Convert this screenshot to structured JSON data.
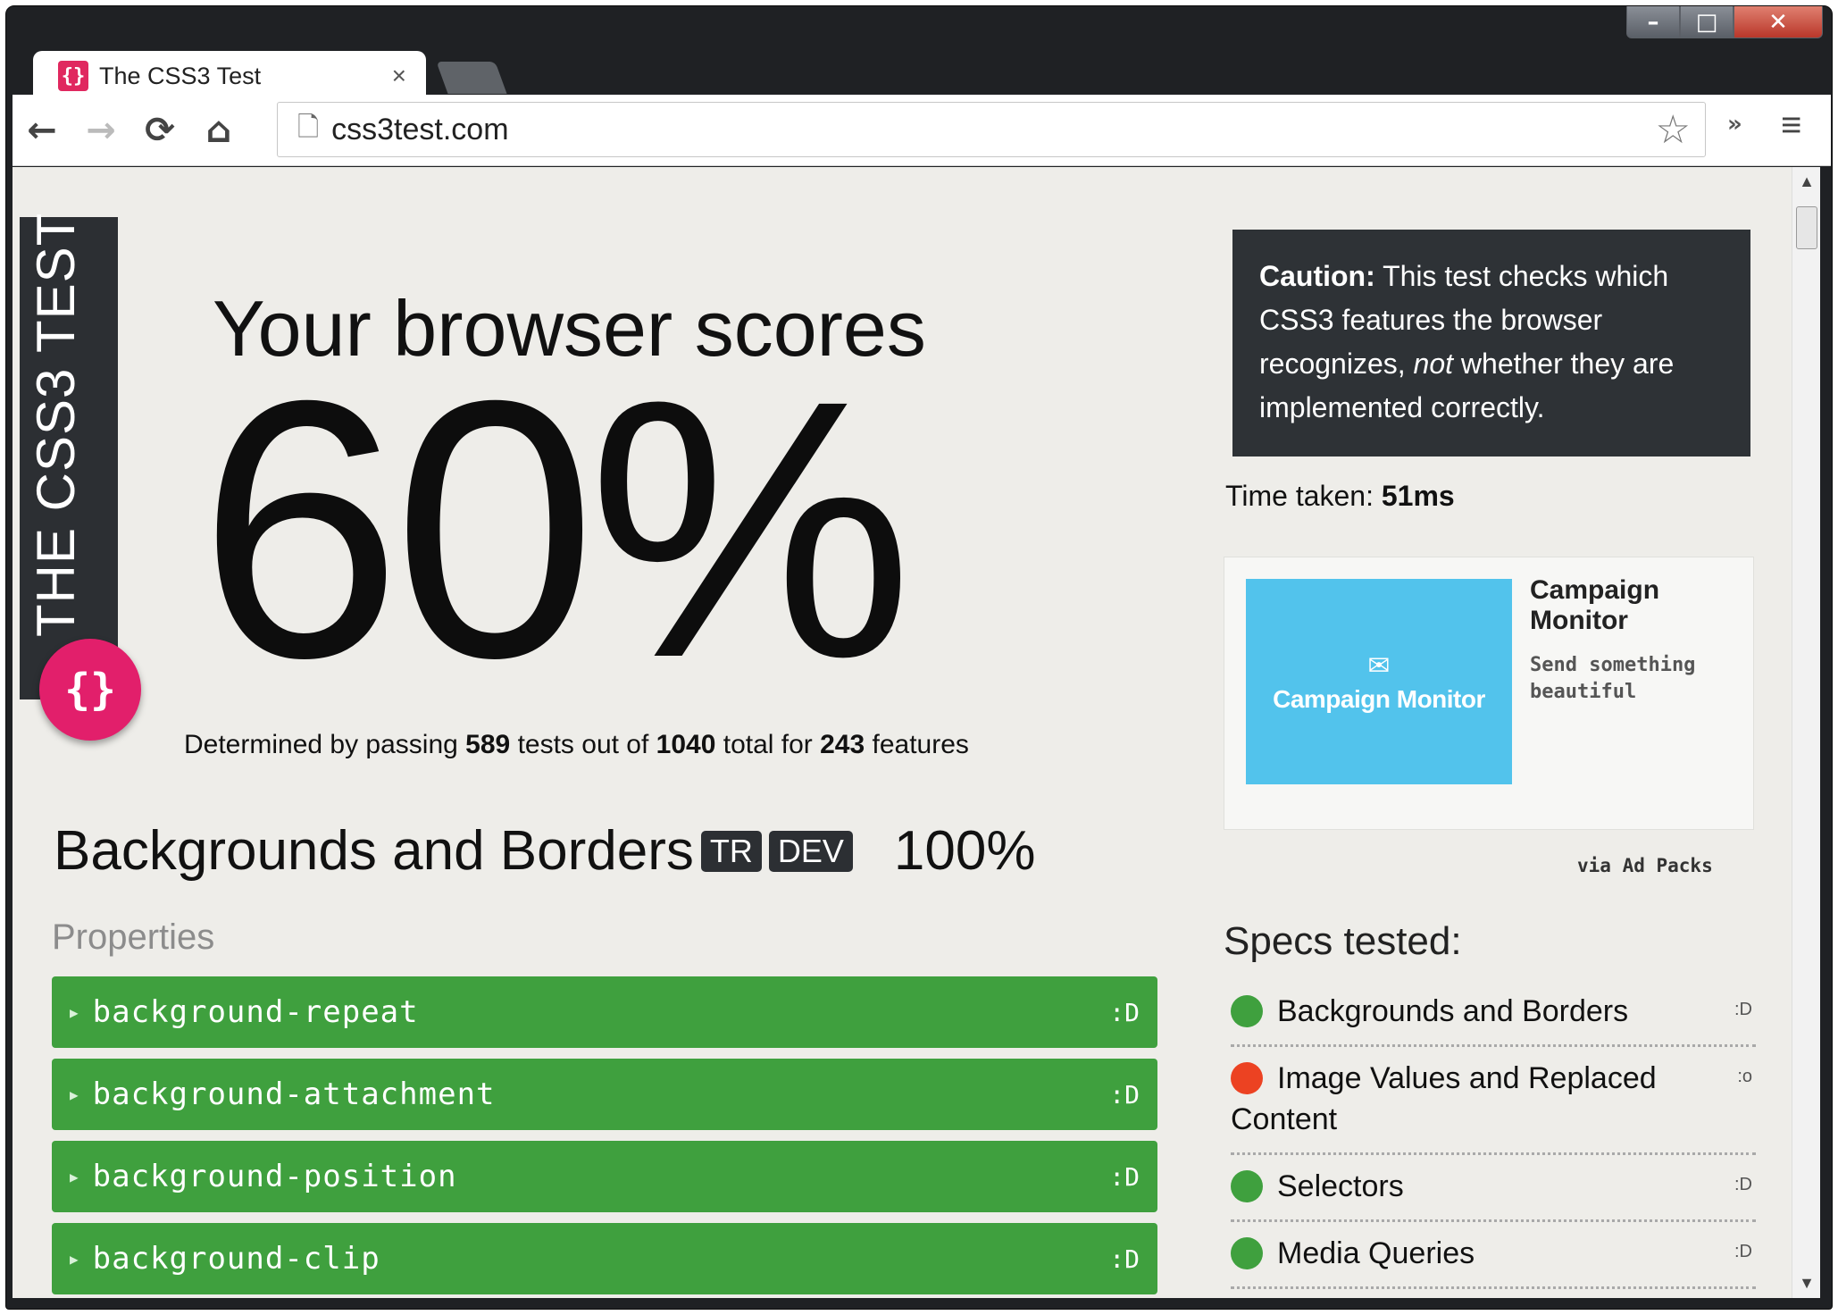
{
  "browser": {
    "tab_title": "The CSS3 Test",
    "tab_favicon": "{}",
    "tab_close": "×",
    "url": "css3test.com",
    "back": "←",
    "forward": "→",
    "reload": "⟳",
    "home": "⌂",
    "star": "☆",
    "extensions": "»",
    "menu": "≡",
    "window_min": "–",
    "window_max": "□",
    "window_close": "✕"
  },
  "ribbon": {
    "title": "THE CSS3 TEST",
    "logo": "{}"
  },
  "score": {
    "heading": "Your browser scores",
    "value": "60%",
    "detail_prefix": "Determined by passing ",
    "passed": "589",
    "detail_mid1": " tests out of ",
    "total": "1040",
    "detail_mid2": " total for ",
    "features": "243",
    "detail_suffix": " features"
  },
  "section": {
    "title": "Backgrounds and Borders",
    "badges": [
      "TR",
      "DEV"
    ],
    "percent": "100%",
    "properties_label": "Properties",
    "properties": [
      {
        "name": "background-repeat",
        "status": ":D"
      },
      {
        "name": "background-attachment",
        "status": ":D"
      },
      {
        "name": "background-position",
        "status": ":D"
      },
      {
        "name": "background-clip",
        "status": ":D"
      }
    ]
  },
  "sidebar": {
    "caution_label": "Caution:",
    "caution_text_1": " This test checks which CSS3 features the browser recognizes, ",
    "caution_em": "not",
    "caution_text_2": " whether they are implemented correctly.",
    "time_label": "Time taken: ",
    "time_value": "51ms",
    "ad": {
      "image_text": "Campaign Monitor",
      "title": "Campaign Monitor",
      "description": "Send something beautiful",
      "via": "via Ad Packs"
    },
    "specs_heading": "Specs tested:",
    "specs": [
      {
        "name": "Backgrounds and Borders",
        "status": ":D",
        "result": "pass"
      },
      {
        "name": "Image Values and Replaced Content",
        "status": ":o",
        "result": "fail"
      },
      {
        "name": "Selectors",
        "status": ":D",
        "result": "pass"
      },
      {
        "name": "Media Queries",
        "status": ":D",
        "result": "pass"
      }
    ]
  },
  "colors": {
    "pass_green": "#3fa03e",
    "fail_red": "#ec4222",
    "brand_pink": "#e21f6b",
    "dark_panel": "#2c2f33",
    "ad_blue": "#52c3ec"
  }
}
